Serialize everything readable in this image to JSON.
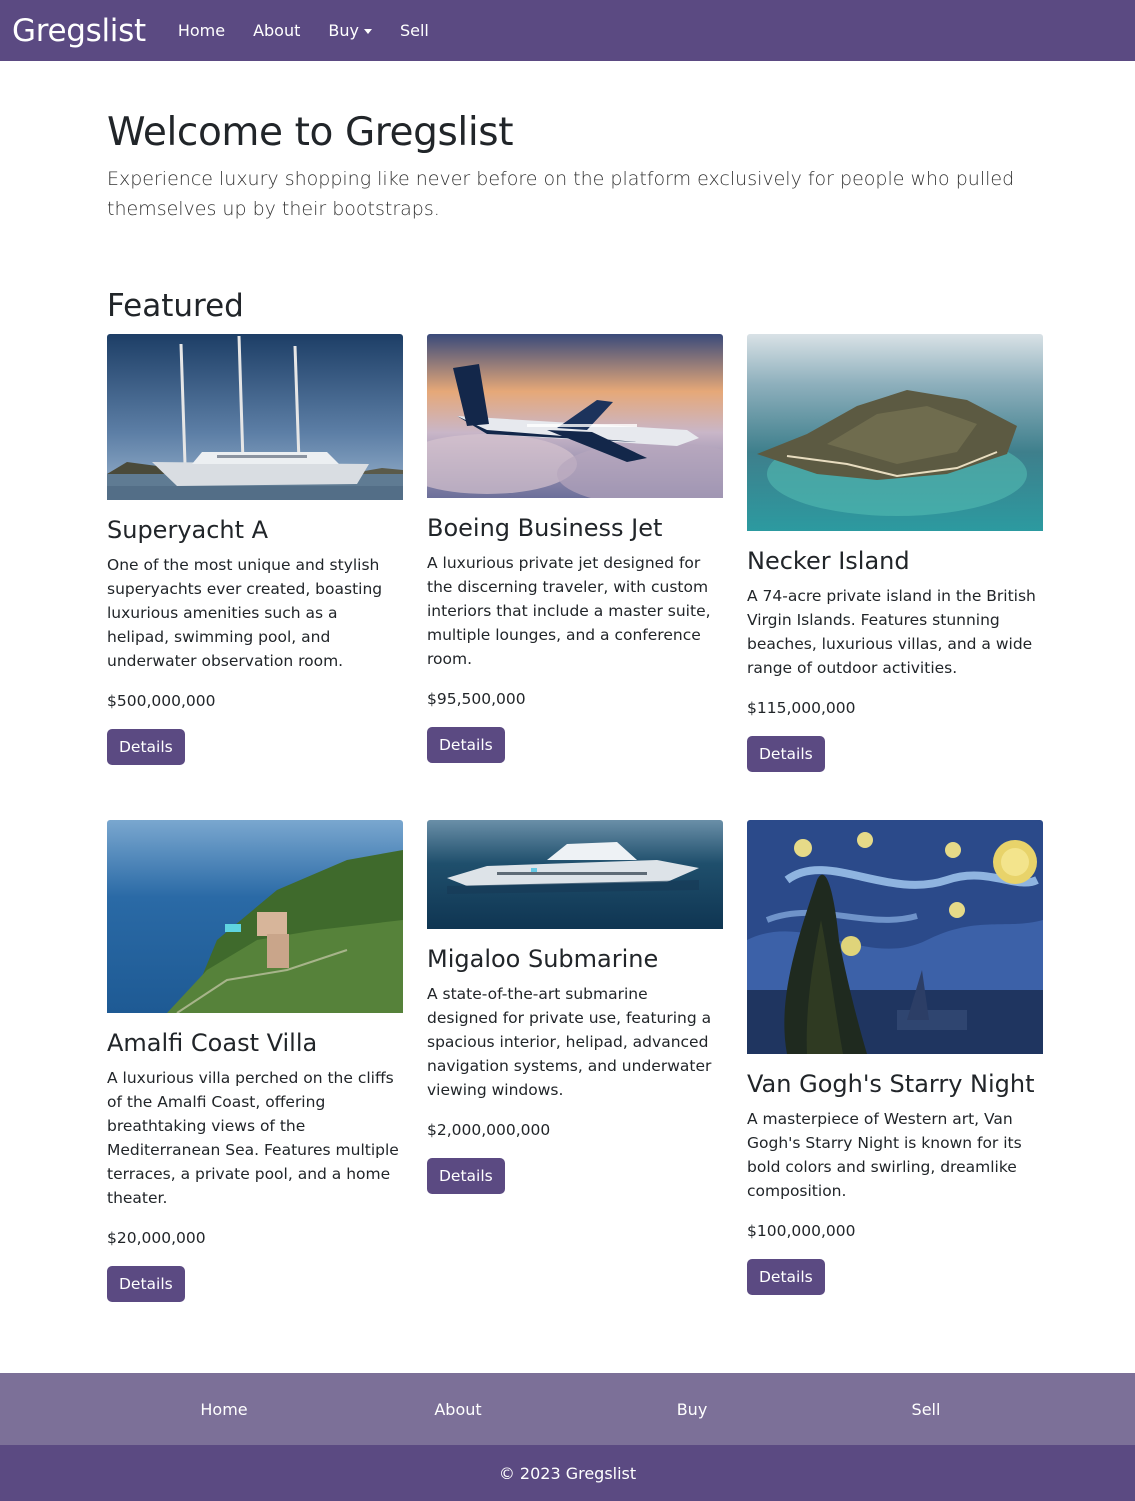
{
  "navbar": {
    "brand": "Gregslist",
    "links": [
      {
        "label": "Home"
      },
      {
        "label": "About"
      },
      {
        "label": "Buy"
      },
      {
        "label": "Sell"
      }
    ]
  },
  "hero": {
    "title": "Welcome to Gregslist",
    "lead": "Experience luxury shopping like never before on the platform exclusively for people who pulled themselves up by their bootstraps."
  },
  "featured": {
    "title": "Featured",
    "button_label": "Details",
    "cards": [
      {
        "title": "Superyacht A",
        "description": "One of the most unique and stylish superyachts ever created, boasting luxurious amenities such as a helipad, swimming pool, and underwater observation room.",
        "price": "$500,000,000",
        "image_icon": "superyacht-image"
      },
      {
        "title": "Boeing Business Jet",
        "description": "A luxurious private jet designed for the discerning traveler, with custom interiors that include a master suite, multiple lounges, and a conference room.",
        "price": "$95,500,000",
        "image_icon": "private-jet-image"
      },
      {
        "title": "Necker Island",
        "description": "A 74-acre private island in the British Virgin Islands. Features stunning beaches, luxurious villas, and a wide range of outdoor activities.",
        "price": "$115,000,000",
        "image_icon": "island-image"
      },
      {
        "title": "Amalfi Coast Villa",
        "description": "A luxurious villa perched on the cliffs of the Amalfi Coast, offering breathtaking views of the Mediterranean Sea. Features multiple terraces, a private pool, and a home theater.",
        "price": "$20,000,000",
        "image_icon": "villa-image"
      },
      {
        "title": "Migaloo Submarine",
        "description": "A state-of-the-art submarine designed for private use, featuring a spacious interior, helipad, advanced navigation systems, and underwater viewing windows.",
        "price": "$2,000,000,000",
        "image_icon": "submarine-image"
      },
      {
        "title": "Van Gogh's Starry Night",
        "description": "A masterpiece of Western art, Van Gogh's Starry Night is known for its bold colors and swirling, dreamlike composition.",
        "price": "$100,000,000",
        "image_icon": "painting-image"
      }
    ]
  },
  "footer": {
    "links": [
      {
        "label": "Home"
      },
      {
        "label": "About"
      },
      {
        "label": "Buy"
      },
      {
        "label": "Sell"
      }
    ],
    "copyright": "© 2023 Gregslist"
  },
  "colors": {
    "brand": "#5b4a82",
    "footer_nav": "#7c7098"
  }
}
